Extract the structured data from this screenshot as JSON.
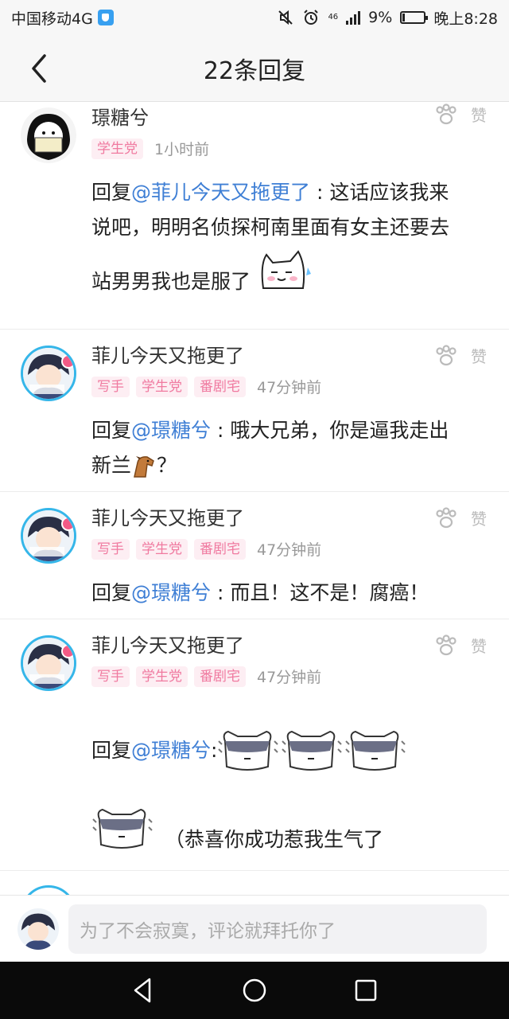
{
  "status_bar": {
    "carrier": "中国移动4G",
    "network_small": "46",
    "battery_pct": "9%",
    "time": "晚上8:28"
  },
  "header": {
    "title": "22条回复",
    "back_icon": "chevron-left-icon"
  },
  "like_label": "赞",
  "replies": [
    {
      "user": "璟糖兮",
      "tags": [
        "学生党"
      ],
      "time": "1小时前",
      "reply_prefix": "回复",
      "mention": "@菲儿今天又拖更了",
      "sep": " : ",
      "text_line1": "这话应该我来",
      "text_line2": "说吧，明明名侦探柯南里面有女主还要去",
      "text_line3": "站男男我也是服了"
    },
    {
      "user": "菲儿今天又拖更了",
      "tags": [
        "写手",
        "学生党",
        "番剧宅"
      ],
      "time": "47分钟前",
      "reply_prefix": "回复",
      "mention": "@璟糖兮",
      "sep": " : ",
      "text_line1": "哦大兄弟，你是逼我走出",
      "text_line2": "新兰",
      "text_line2_end": "？"
    },
    {
      "user": "菲儿今天又拖更了",
      "tags": [
        "写手",
        "学生党",
        "番剧宅"
      ],
      "time": "47分钟前",
      "reply_prefix": "回复",
      "mention": "@璟糖兮",
      "sep": " : ",
      "text_line1": "而且！这不是！腐癌！"
    },
    {
      "user": "菲儿今天又拖更了",
      "tags": [
        "写手",
        "学生党",
        "番剧宅"
      ],
      "time": "47分钟前",
      "reply_prefix": "回复",
      "mention": "@璟糖兮",
      "sep": " : ",
      "text_line2": "（恭喜你成功惹我生气了"
    }
  ],
  "composer": {
    "placeholder": "为了不会寂寞，评论就拜托你了"
  },
  "nav": [
    "back-triangle-icon",
    "home-circle-icon",
    "recents-square-icon"
  ]
}
